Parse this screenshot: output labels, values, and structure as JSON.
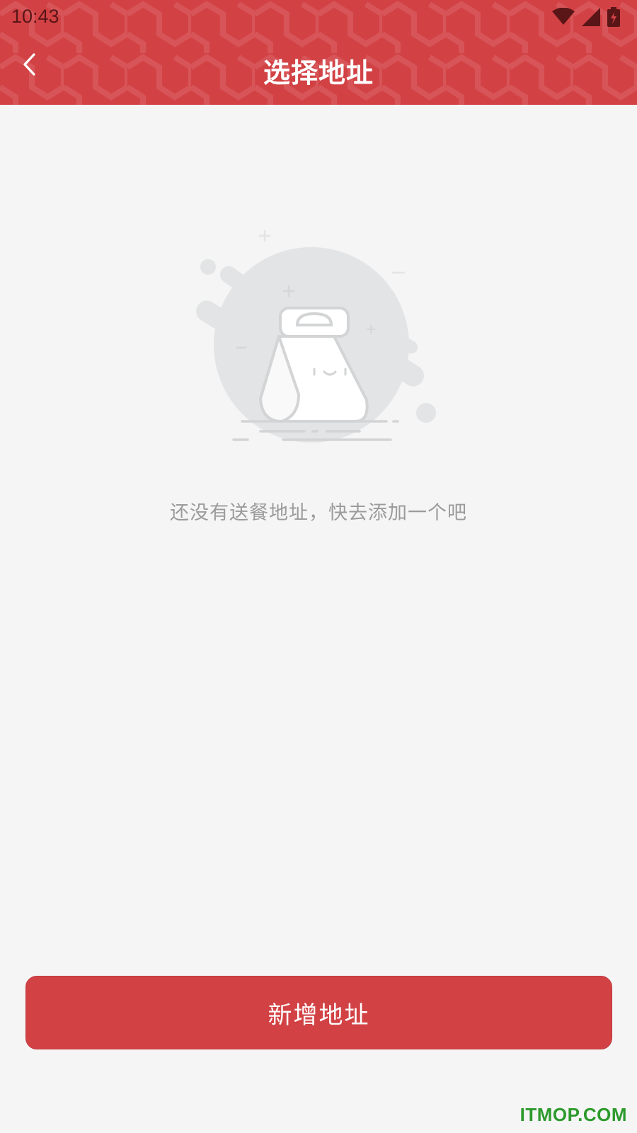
{
  "status_bar": {
    "time": "10:43",
    "icons": [
      "wifi-icon",
      "signal-icon",
      "battery-charging-icon"
    ]
  },
  "header": {
    "title": "选择地址",
    "back_icon": "chevron-left-icon"
  },
  "empty_state": {
    "illustration": "empty-bag-illustration",
    "message": "还没有送餐地址，快去添加一个吧"
  },
  "footer": {
    "add_button_label": "新增地址"
  },
  "watermark": "ITMOP.COM",
  "colors": {
    "primary": "#d24245",
    "background": "#f5f5f5",
    "muted_text": "#9b9b9b",
    "watermark": "#2c9a2c"
  }
}
